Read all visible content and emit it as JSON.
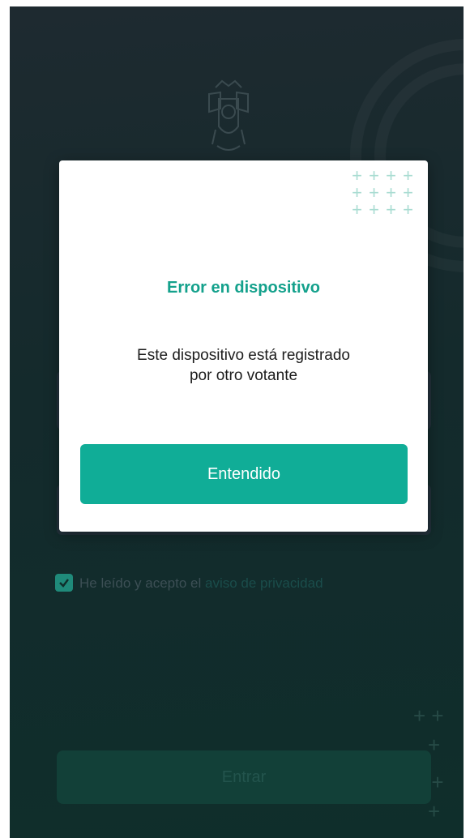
{
  "modal": {
    "title": "Error en dispositivo",
    "message_line1": "Este dispositivo está registrado",
    "message_line2": "por otro votante",
    "button_label": "Entendido"
  },
  "background": {
    "privacy_prefix": "He leído y acepto el",
    "privacy_link": "aviso de privacidad",
    "privacy_checked": true,
    "submit_label": "Entrar"
  },
  "colors": {
    "accent": "#10ad97",
    "title": "#14a18c",
    "background": "#142a2c"
  },
  "icons": {
    "crest": "state-coat-of-arms-icon",
    "checkbox": "check-icon",
    "decoration": "plus-icon"
  }
}
